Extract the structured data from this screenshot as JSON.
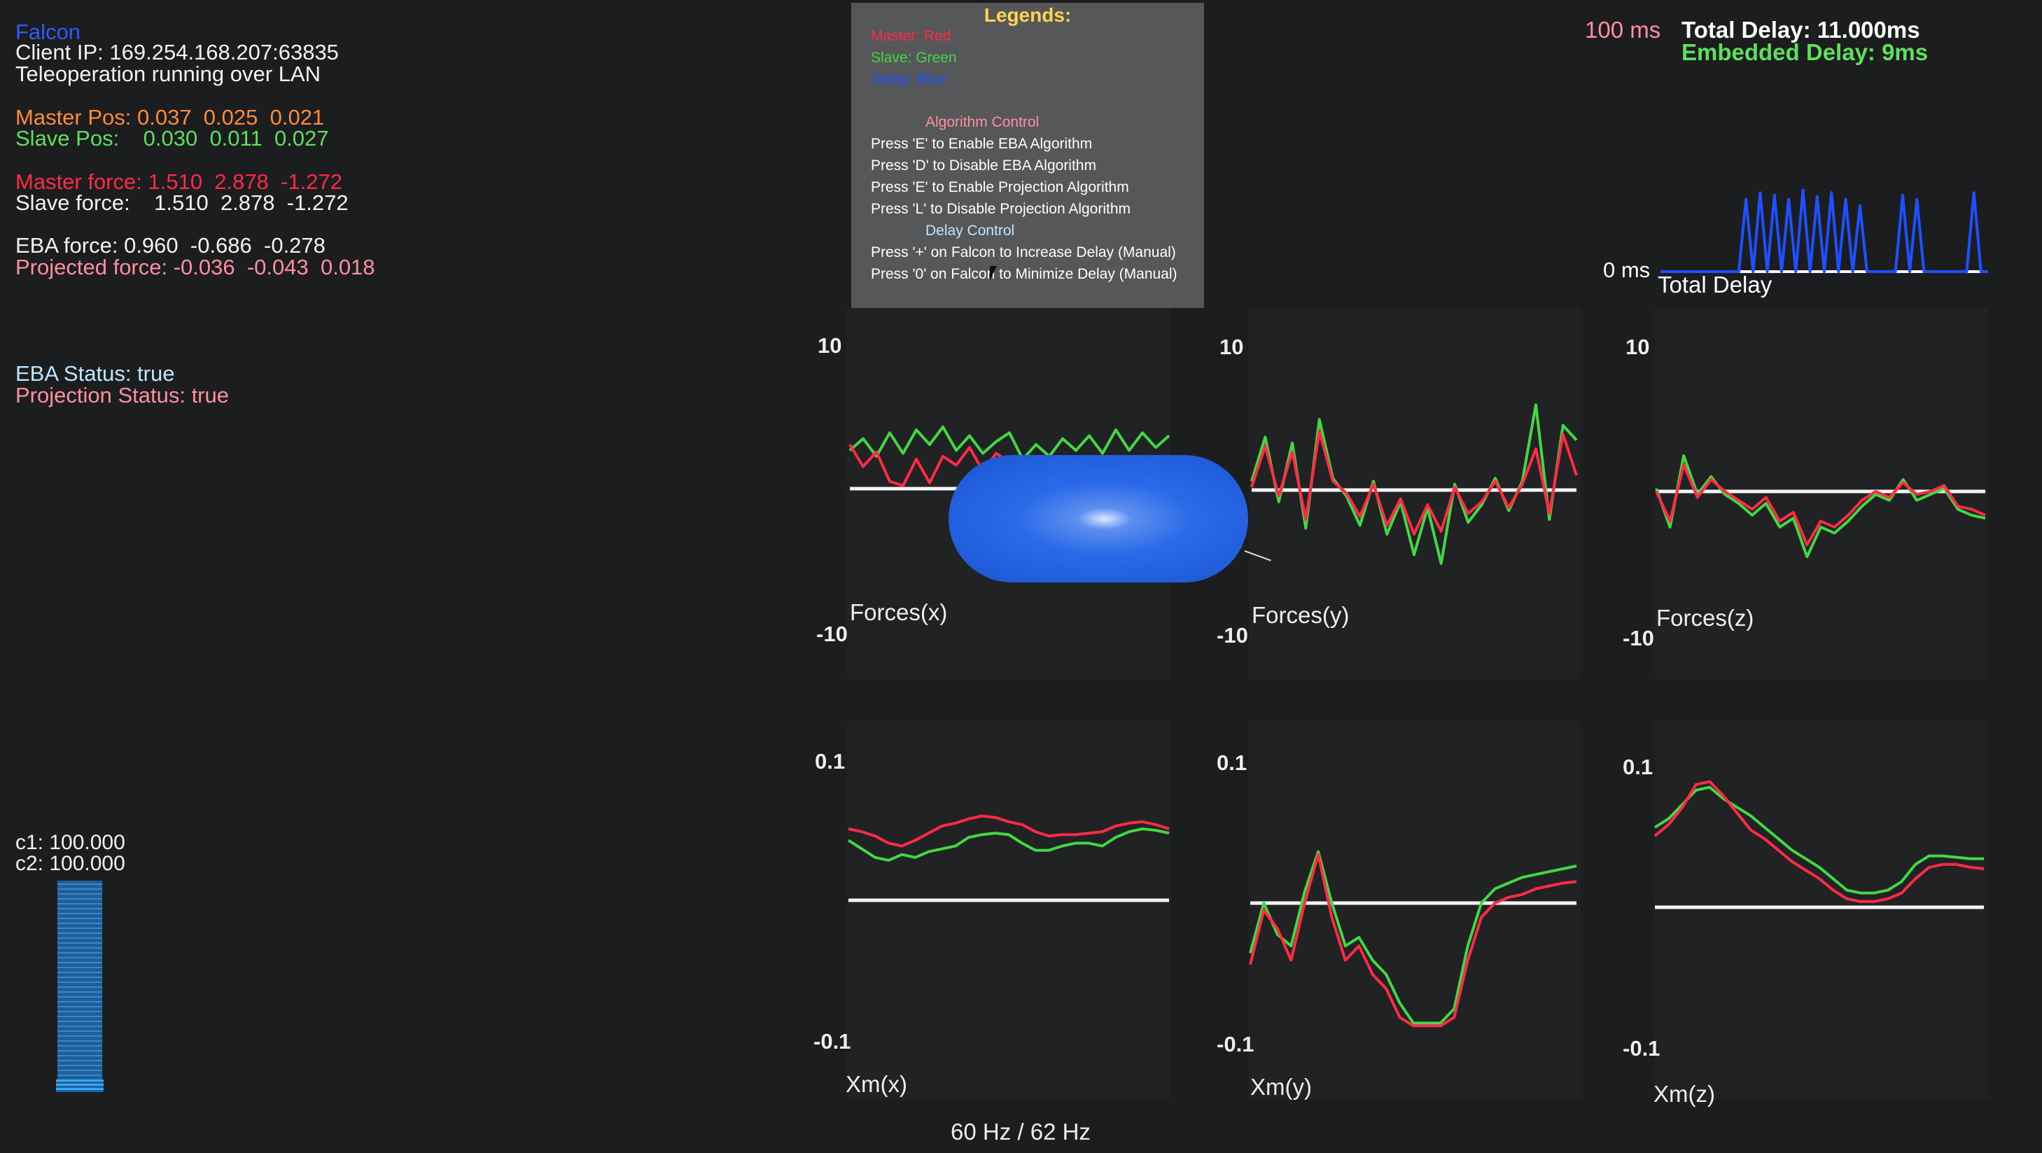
{
  "status": {
    "app_name": "Falcon",
    "client_ip": "Client IP: 169.254.168.207:63835",
    "teleop": "Teleoperation running over LAN",
    "master_pos": "Master Pos: 0.037  0.025  0.021",
    "slave_pos": "Slave Pos:    0.030  0.011  0.027",
    "master_force": "Master force: 1.510  2.878  -1.272",
    "slave_force": "Slave force:    1.510  2.878  -1.272",
    "eba_force": "EBA force: 0.960  -0.686  -0.278",
    "projected_force": "Projected force: -0.036  -0.043  0.018",
    "eba_status": "EBA Status: true",
    "projection_status": "Projection Status: true",
    "c1": "c1: 100.000",
    "c2": "c2: 100.000",
    "slider_level": 0.97
  },
  "legend": {
    "title": "Legends:",
    "master": "Master: Red",
    "slave": "Slave: Green",
    "delay": "Delay: Blue",
    "algo_header": "Algorithm Control",
    "algo_items": [
      "Press 'E' to Enable EBA Algorithm",
      "Press 'D' to Disable EBA Algorithm",
      "Press 'E' to Enable Projection Algorithm",
      "Press 'L' to Disable Projection Algorithm"
    ],
    "delay_header": "Delay Control",
    "delay_items": [
      "Press '+' on Falcon to Increase Delay (Manual)",
      "Press '0' on Falcon to Minimize Delay (Manual)"
    ]
  },
  "delay": {
    "top_label": "100 ms",
    "bottom_label": "0 ms",
    "total": "Total Delay: 11.000ms",
    "embedded": "Embedded Delay: 9ms",
    "title": "Total Delay"
  },
  "plots": {
    "force_max": "10",
    "force_min": "-10",
    "pos_max": "0.1",
    "pos_min": "-0.1",
    "titles": [
      "Forces(x)",
      "Forces(y)",
      "Forces(z)",
      "Xm(x)",
      "Xm(y)",
      "Xm(z)"
    ]
  },
  "footer": {
    "rate": "60 Hz / 62 Hz"
  },
  "colors": {
    "master": "#ff2a45",
    "slave": "#43d843",
    "delay": "#1e50ff",
    "zero_line": "#f4f4f4",
    "background": "#1b1d1f",
    "panel": "#202224",
    "legend_panel": "#565759"
  },
  "chart_data": [
    {
      "type": "line",
      "title": "Forces(x)",
      "ylim": [
        -10,
        10
      ],
      "series": [
        {
          "name": "Master: Red",
          "values": [
            3.0,
            1.5,
            2.5,
            0.5,
            0.2,
            2.0,
            0.4,
            2.2,
            1.6,
            2.8,
            1.2,
            2.4,
            1.8,
            0.0,
            2.1,
            0.3,
            0.1,
            0.2,
            0.1,
            0.0,
            2.0,
            0.2,
            0.0,
            1.8,
            0.0
          ]
        },
        {
          "name": "Slave: Green",
          "values": [
            2.6,
            3.4,
            2.2,
            3.8,
            2.4,
            4.0,
            3.0,
            4.2,
            2.6,
            3.6,
            2.4,
            3.2,
            3.8,
            2.0,
            3.0,
            2.2,
            3.4,
            2.6,
            3.6,
            2.4,
            4.0,
            2.6,
            3.8,
            2.8,
            3.6
          ]
        }
      ]
    },
    {
      "type": "line",
      "title": "Forces(y)",
      "ylim": [
        -10,
        10
      ],
      "series": [
        {
          "name": "Master: Red",
          "values": [
            0.2,
            3.0,
            -0.4,
            2.6,
            -2.0,
            4.0,
            0.6,
            -0.2,
            -1.8,
            0.4,
            -2.4,
            -0.6,
            -3.0,
            -1.0,
            -2.8,
            0.2,
            -1.6,
            -0.8,
            0.6,
            -1.2,
            0.4,
            2.8,
            -1.6,
            3.8,
            1.0
          ]
        },
        {
          "name": "Slave: Green",
          "values": [
            0.6,
            3.6,
            -0.8,
            3.2,
            -2.6,
            4.8,
            0.8,
            -0.4,
            -2.4,
            0.6,
            -3.0,
            -0.8,
            -4.4,
            -1.2,
            -5.0,
            0.4,
            -2.2,
            -1.0,
            0.8,
            -1.4,
            0.6,
            5.8,
            -2.0,
            4.4,
            3.4
          ]
        }
      ]
    },
    {
      "type": "line",
      "title": "Forces(z)",
      "ylim": [
        -10,
        10
      ],
      "series": [
        {
          "name": "Master: Red",
          "values": [
            0.0,
            -2.0,
            1.8,
            -0.4,
            0.8,
            0.0,
            -0.6,
            -1.2,
            -0.4,
            -2.0,
            -1.4,
            -3.6,
            -2.0,
            -2.4,
            -1.6,
            -0.6,
            0.0,
            -0.4,
            0.6,
            -0.2,
            0.0,
            0.4,
            -1.0,
            -1.2,
            -1.6
          ]
        },
        {
          "name": "Slave: Green",
          "values": [
            0.2,
            -2.4,
            2.4,
            -0.2,
            1.0,
            -0.2,
            -0.8,
            -1.6,
            -0.8,
            -2.4,
            -1.8,
            -4.4,
            -2.4,
            -2.8,
            -2.0,
            -1.0,
            -0.2,
            -0.6,
            0.8,
            -0.6,
            -0.2,
            0.2,
            -1.2,
            -1.6,
            -1.8
          ]
        }
      ]
    },
    {
      "type": "line",
      "title": "Xm(x)",
      "ylim": [
        -0.1,
        0.1
      ],
      "series": [
        {
          "name": "Master: Red",
          "values": [
            0.05,
            0.048,
            0.045,
            0.04,
            0.038,
            0.042,
            0.047,
            0.052,
            0.054,
            0.057,
            0.059,
            0.058,
            0.055,
            0.053,
            0.048,
            0.045,
            0.046,
            0.046,
            0.047,
            0.048,
            0.052,
            0.054,
            0.055,
            0.053,
            0.05
          ]
        },
        {
          "name": "Slave: Green",
          "values": [
            0.042,
            0.036,
            0.03,
            0.028,
            0.032,
            0.03,
            0.034,
            0.036,
            0.038,
            0.044,
            0.046,
            0.047,
            0.046,
            0.04,
            0.035,
            0.035,
            0.038,
            0.04,
            0.04,
            0.038,
            0.044,
            0.048,
            0.05,
            0.049,
            0.047
          ]
        }
      ]
    },
    {
      "type": "line",
      "title": "Xm(y)",
      "ylim": [
        -0.1,
        0.1
      ],
      "series": [
        {
          "name": "Master: Red",
          "values": [
            -0.043,
            -0.005,
            -0.018,
            -0.04,
            0.0,
            0.034,
            -0.01,
            -0.04,
            -0.03,
            -0.05,
            -0.06,
            -0.08,
            -0.086,
            -0.086,
            -0.086,
            -0.08,
            -0.04,
            -0.01,
            0.0,
            0.004,
            0.006,
            0.01,
            0.012,
            0.014,
            0.015
          ]
        },
        {
          "name": "Slave: Green",
          "values": [
            -0.035,
            0.0,
            -0.022,
            -0.03,
            0.008,
            0.036,
            0.0,
            -0.03,
            -0.024,
            -0.04,
            -0.05,
            -0.07,
            -0.084,
            -0.084,
            -0.084,
            -0.074,
            -0.03,
            0.0,
            0.01,
            0.014,
            0.018,
            0.02,
            0.022,
            0.024,
            0.026
          ]
        }
      ]
    },
    {
      "type": "line",
      "title": "Xm(z)",
      "ylim": [
        -0.1,
        0.1
      ],
      "series": [
        {
          "name": "Master: Red",
          "values": [
            0.05,
            0.058,
            0.07,
            0.086,
            0.088,
            0.078,
            0.066,
            0.054,
            0.048,
            0.04,
            0.032,
            0.026,
            0.02,
            0.012,
            0.006,
            0.004,
            0.004,
            0.006,
            0.01,
            0.02,
            0.028,
            0.03,
            0.03,
            0.028,
            0.027
          ]
        },
        {
          "name": "Slave: Green",
          "values": [
            0.056,
            0.062,
            0.072,
            0.082,
            0.084,
            0.076,
            0.07,
            0.064,
            0.056,
            0.048,
            0.04,
            0.034,
            0.028,
            0.02,
            0.012,
            0.01,
            0.01,
            0.012,
            0.018,
            0.03,
            0.036,
            0.036,
            0.035,
            0.034,
            0.034
          ]
        }
      ]
    },
    {
      "type": "line",
      "title": "Total Delay",
      "ylim": [
        0,
        100
      ],
      "series": [
        {
          "name": "Delay: Blue",
          "values": [
            0,
            0,
            0,
            0,
            0,
            0,
            0,
            0,
            0,
            0,
            0,
            0,
            55,
            0,
            60,
            0,
            58,
            0,
            55,
            0,
            62,
            0,
            57,
            0,
            60,
            0,
            55,
            0,
            50,
            0,
            0,
            0,
            0,
            0,
            58,
            0,
            55,
            0,
            0,
            0,
            0,
            0,
            0,
            0,
            60,
            0,
            0
          ]
        }
      ]
    }
  ]
}
